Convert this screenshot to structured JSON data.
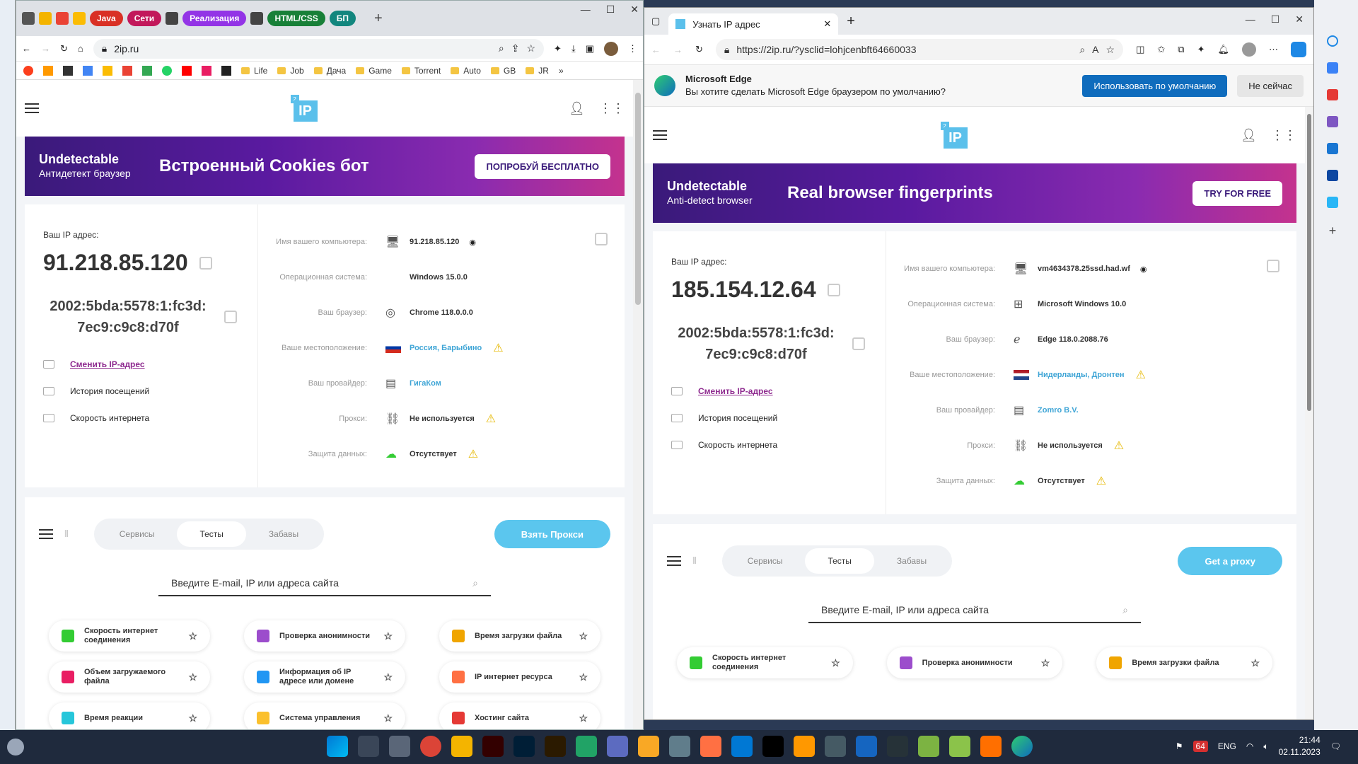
{
  "chrome": {
    "tabs": [
      {
        "label": "Java",
        "color": "#d93025"
      },
      {
        "label": "Сети",
        "color": "#c2185b"
      },
      {
        "label": "Реализация",
        "color": "#9334e6"
      },
      {
        "label": "HTML/CSS",
        "color": "#188038"
      },
      {
        "label": "БП",
        "color": "#12867e"
      }
    ],
    "url": "2ip.ru",
    "bookmarks": [
      "Life",
      "Job",
      "Дача",
      "Game",
      "Torrent",
      "Auto",
      "GB",
      "JR"
    ]
  },
  "edge": {
    "tab_title": "Узнать IP адрес",
    "url": "https://2ip.ru/?ysclid=lohjcenbft64660033",
    "banner": {
      "title": "Microsoft Edge",
      "text": "Вы хотите сделать Microsoft Edge браузером по умолчанию?",
      "primary": "Использовать по умолчанию",
      "secondary": "Не сейчас"
    }
  },
  "site_left": {
    "ad": {
      "brand": "Undetectable",
      "sub": "Антидетект браузер",
      "slogan": "Встроенный Cookies бот",
      "cta": "ПОПРОБУЙ БЕСПЛАТНО"
    },
    "ip_label": "Ваш IP адрес:",
    "ipv4": "91.218.85.120",
    "ipv6": "2002:5bda:5578:1:fc3d: 7ec9:c9c8:d70f",
    "change_ip": "Сменить IP-адрес",
    "history": "История посещений",
    "speed": "Скорость интернета",
    "info": [
      {
        "k": "Имя вашего компьютера:",
        "v": "91.218.85.120"
      },
      {
        "k": "Операционная система:",
        "v": "Windows 15.0.0"
      },
      {
        "k": "Ваш браузер:",
        "v": "Chrome 118.0.0.0"
      },
      {
        "k": "Ваше местоположение:",
        "v": "Россия, Барыбино"
      },
      {
        "k": "Ваш провайдер:",
        "v": "ГигаКом"
      },
      {
        "k": "Прокси:",
        "v": "Не используется"
      },
      {
        "k": "Защита данных:",
        "v": "Отсутствует"
      }
    ],
    "seg": [
      "Сервисы",
      "Тесты",
      "Забавы"
    ],
    "proxy_btn": "Взять Прокси",
    "search_placeholder": "Введите E-mail, IP или адреса сайта",
    "tiles": [
      "Скорость интернет соединения",
      "Проверка анонимности",
      "Время загрузки файла",
      "Объем загружаемого файла",
      "Информация об IP адресе или домене",
      "IP интернет ресурса",
      "Время реакции",
      "Система управления",
      "Хостинг сайта"
    ]
  },
  "site_right": {
    "ad": {
      "brand": "Undetectable",
      "sub": "Anti-detect browser",
      "slogan": "Real browser fingerprints",
      "cta": "TRY FOR FREE"
    },
    "ip_label": "Ваш IP адрес:",
    "ipv4": "185.154.12.64",
    "ipv6": "2002:5bda:5578:1:fc3d: 7ec9:c9c8:d70f",
    "change_ip": "Сменить IP-адрес",
    "history": "История посещений",
    "speed": "Скорость интернета",
    "info": [
      {
        "k": "Имя вашего компьютера:",
        "v": "vm4634378.25ssd.had.wf"
      },
      {
        "k": "Операционная система:",
        "v": "Microsoft Windows 10.0"
      },
      {
        "k": "Ваш браузер:",
        "v": "Edge 118.0.2088.76"
      },
      {
        "k": "Ваше местоположение:",
        "v": "Нидерланды, Дронтен"
      },
      {
        "k": "Ваш провайдер:",
        "v": "Zomro B.V."
      },
      {
        "k": "Прокси:",
        "v": "Не используется"
      },
      {
        "k": "Защита данных:",
        "v": "Отсутствует"
      }
    ],
    "seg": [
      "Сервисы",
      "Тесты",
      "Забавы"
    ],
    "proxy_btn": "Get a proxy",
    "search_placeholder": "Введите E-mail, IP или адреса сайта",
    "tiles": [
      "Скорость интернет соединения",
      "Проверка анонимности",
      "Время загрузки файла"
    ]
  },
  "taskbar": {
    "lang": "ENG",
    "time": "21:44",
    "date": "02.11.2023",
    "badge": "64"
  }
}
